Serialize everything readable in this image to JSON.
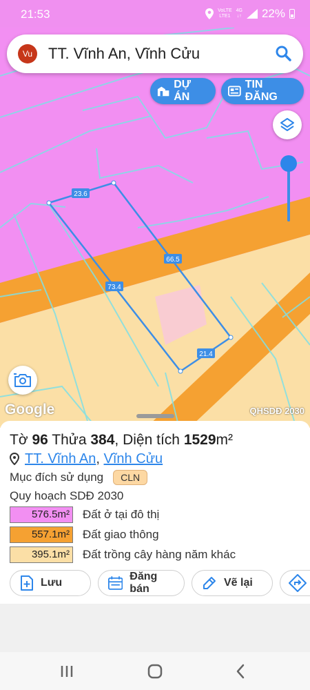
{
  "status_bar": {
    "time": "21:53",
    "network_top": "VoLTE",
    "network_bottom": "LTE1",
    "signal": "4G",
    "battery": "22%"
  },
  "search": {
    "avatar_text": "Vu",
    "query": "TT. Vĩnh An, Vĩnh Cửu",
    "icon": "search-icon"
  },
  "chips": {
    "project_label": "DỰ ÁN",
    "listing_label": "TIN ĐĂNG"
  },
  "map": {
    "edge_labels": [
      "23.6",
      "66.5",
      "73.4",
      "21.4"
    ],
    "attribution": "Google",
    "layer_label": "QHSDĐ 2030",
    "opacity_level": 1.0,
    "colors": {
      "urban_land": "#f28ff2",
      "transport_land": "#f5a132",
      "annual_crops": "#fbdfa6",
      "parcel_outline": "#3d8ee6"
    }
  },
  "sheet": {
    "title_prefix": "Tờ",
    "sheet_no": "96",
    "title_mid": "Thửa",
    "parcel_no": "384",
    "title_area_label": ", Diện tích",
    "area_value": "1529",
    "area_unit": "m²",
    "location_ward": "TT. Vĩnh An",
    "location_sep": ",",
    "location_district": "Vĩnh Cửu",
    "purpose_label": "Mục đích sử dụng",
    "purpose_code": "CLN",
    "plan_label": "Quy hoạch SDĐ 2030",
    "zones": [
      {
        "area": "576.5m²",
        "label": "Đất ở tại đô thị",
        "color": "#f28ff2"
      },
      {
        "area": "557.1m²",
        "label": "Đất giao thông",
        "color": "#f5a132"
      },
      {
        "area": "395.1m²",
        "label": "Đất trồng cây hàng năm khác",
        "color": "#fbdfa6"
      }
    ],
    "actions": {
      "save": "Lưu",
      "sell": "Đăng bán",
      "redraw": "Vẽ lại"
    }
  }
}
